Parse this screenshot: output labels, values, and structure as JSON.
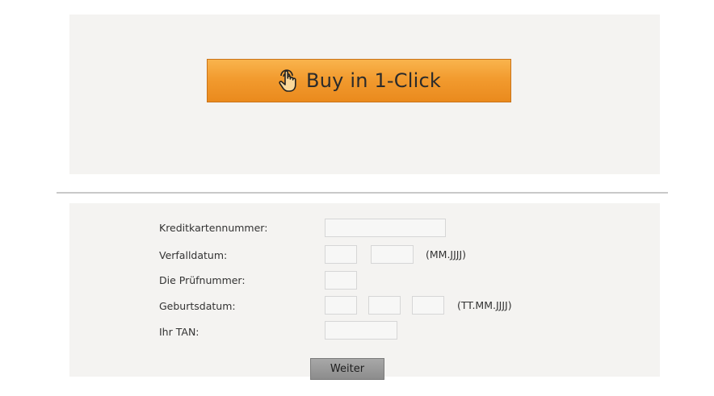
{
  "buy_button": {
    "label": "Buy in 1-Click",
    "icon": "touch-hand-icon",
    "color_top": "#f9b44d",
    "color_bottom": "#ea8a1d"
  },
  "form": {
    "card_number_label": "Kreditkartennummer:",
    "expiry_label": "Verfalldatum:",
    "expiry_format_hint": "(MM.JJJJ)",
    "cvv_label": "Die Prüfnummer:",
    "birthdate_label": "Geburtsdatum:",
    "birthdate_format_hint": "(TT.MM.JJJJ)",
    "tan_label": "Ihr TAN:",
    "submit_label": "Weiter"
  }
}
